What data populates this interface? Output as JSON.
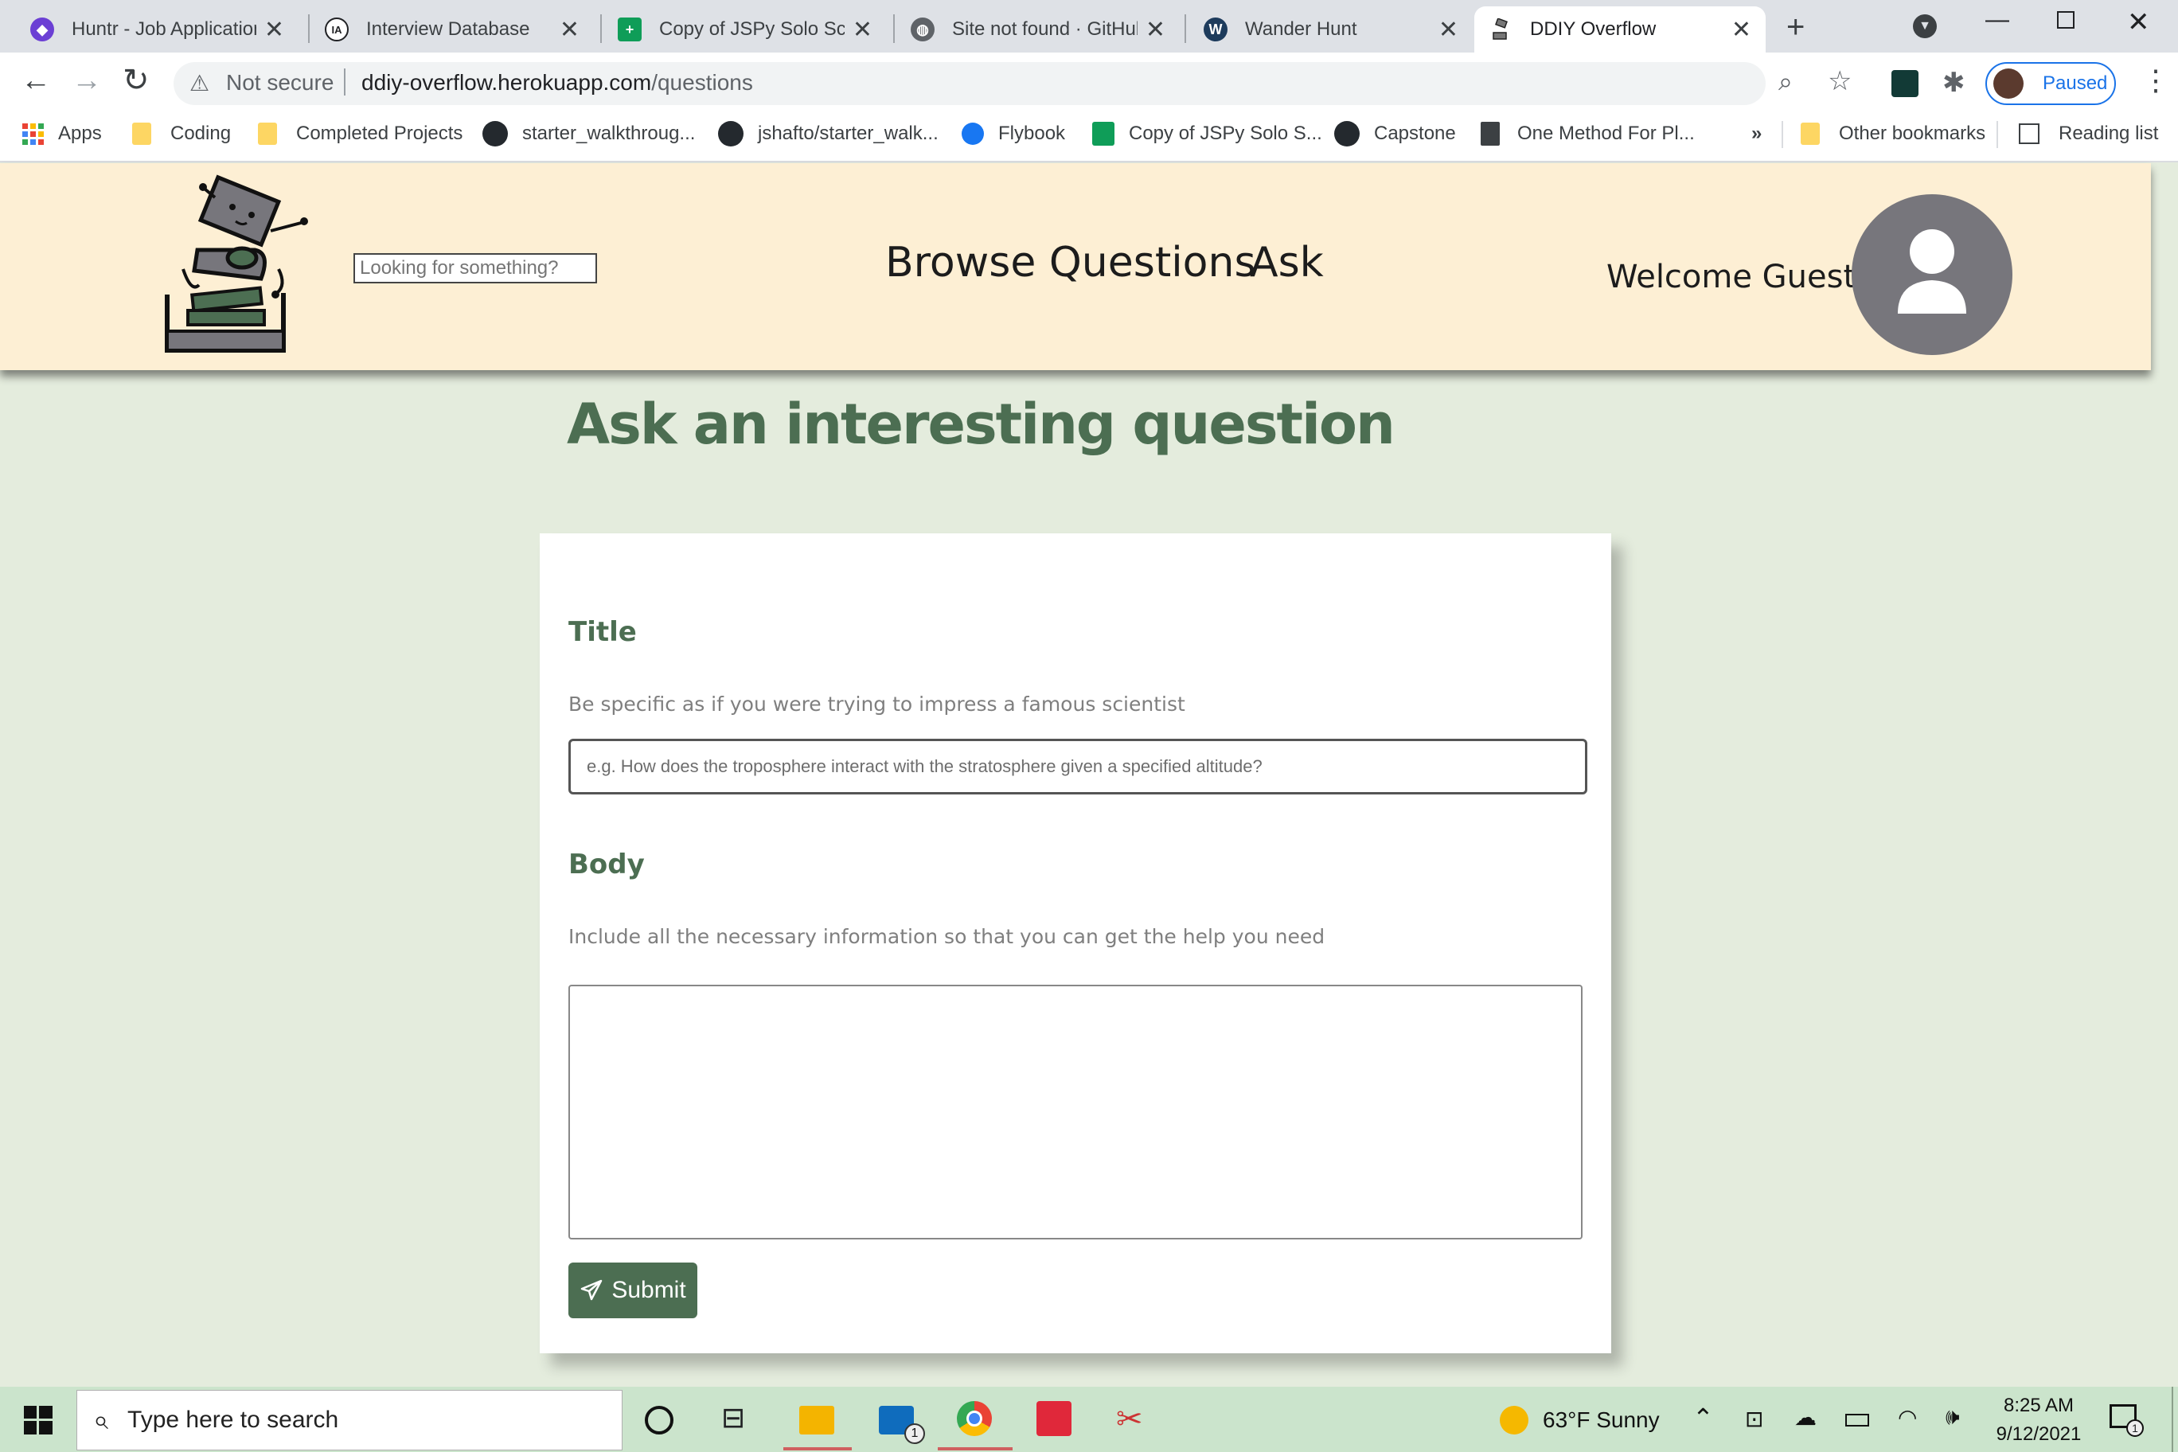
{
  "browser": {
    "tabs": [
      {
        "title": "Huntr - Job Application",
        "favicon": "huntr-icon",
        "color": "#6b3fd4",
        "active": false
      },
      {
        "title": "Interview Database",
        "favicon": "interview-db-icon",
        "color": "#202124",
        "active": false
      },
      {
        "title": "Copy of JSPy Solo Sco",
        "favicon": "sheets-icon",
        "color": "#0f9d58",
        "active": false
      },
      {
        "title": "Site not found · GitHub",
        "favicon": "globe-icon",
        "color": "#5f6368",
        "active": false
      },
      {
        "title": "Wander Hunt",
        "favicon": "wander-hunt-icon",
        "color": "#1d3b5c",
        "active": false
      },
      {
        "title": "DDIY Overflow",
        "favicon": "ddiy-overflow-icon",
        "color": "#555555",
        "active": true
      }
    ],
    "address": {
      "security": "Not secure",
      "domain": "ddiy-overflow.herokuapp.com",
      "path": "/questions"
    },
    "profile_status": "Paused",
    "bookmarks": {
      "apps": "Apps",
      "coding": "Coding",
      "completed_projects": "Completed Projects",
      "starter_walkthrough": "starter_walkthroug...",
      "jshafto": "jshafto/starter_walk...",
      "flybook": "Flybook",
      "copy_jspy": "Copy of JSPy Solo S...",
      "capstone": "Capstone",
      "one_method": "One Method For Pl...",
      "overflow": "»",
      "other": "Other bookmarks",
      "reading_list": "Reading list"
    }
  },
  "site": {
    "search_placeholder": "Looking for something?",
    "nav_browse": "Browse Questions",
    "nav_ask": "Ask",
    "welcome": "Welcome Guest!"
  },
  "form": {
    "page_title": "Ask an interesting question",
    "title_label": "Title",
    "title_hint": "Be specific as if you were trying to impress a famous scientist",
    "title_placeholder": "e.g. How does the troposphere interact with the stratosphere given a specified altitude?",
    "body_label": "Body",
    "body_hint": "Include all the necessary information so that you can get the help you need",
    "submit_label": "Submit"
  },
  "taskbar": {
    "search_placeholder": "Type here to search",
    "mail_badge": "1",
    "weather": "63°F  Sunny",
    "time": "8:25 AM",
    "date": "9/12/2021",
    "notification_badge": "1"
  },
  "colors": {
    "page_bg": "#e4ecdd",
    "header_bg": "#fdefd4",
    "accent_green": "#4c6e52",
    "taskbar_bg": "#cbe4cc"
  }
}
